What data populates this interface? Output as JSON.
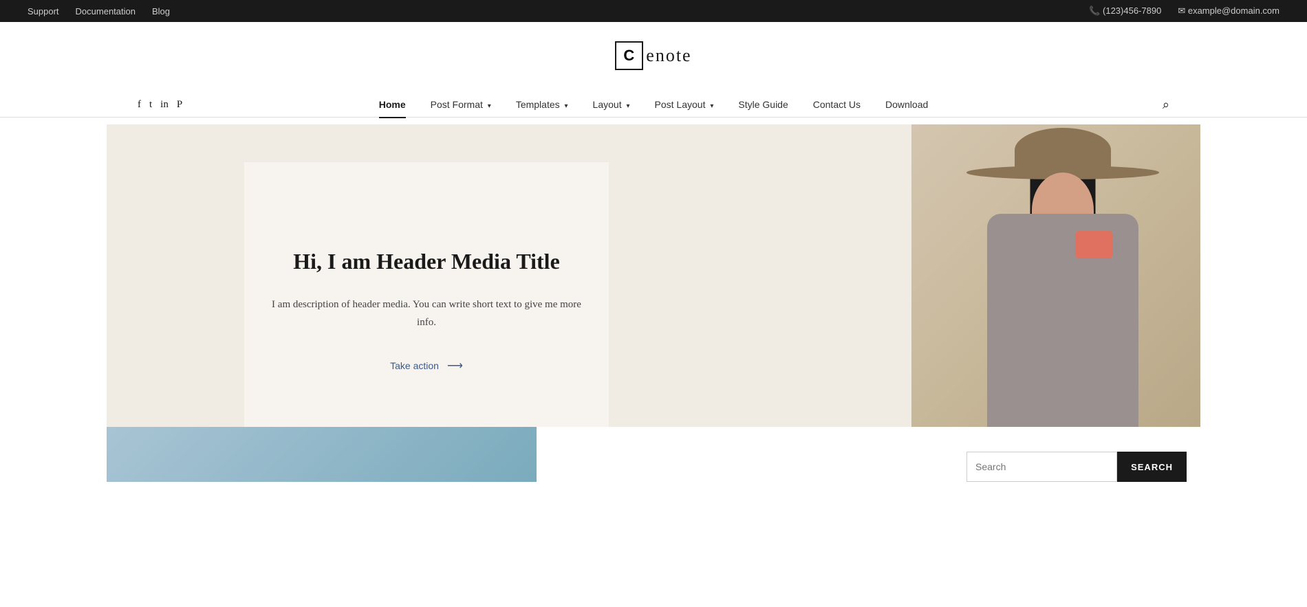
{
  "topbar": {
    "links": [
      "Support",
      "Documentation",
      "Blog"
    ],
    "phone": "(123)456-7890",
    "email": "example@domain.com",
    "phone_icon": "📞",
    "email_icon": "✉"
  },
  "logo": {
    "letter": "C",
    "brand": "enote"
  },
  "social": {
    "facebook": "f",
    "twitter": "𝕏",
    "linkedin": "in",
    "pinterest": "P"
  },
  "nav": {
    "items": [
      {
        "label": "Home",
        "active": true,
        "has_dropdown": false
      },
      {
        "label": "Post Format",
        "active": false,
        "has_dropdown": true
      },
      {
        "label": "Templates",
        "active": false,
        "has_dropdown": true
      },
      {
        "label": "Layout",
        "active": false,
        "has_dropdown": true
      },
      {
        "label": "Post Layout",
        "active": false,
        "has_dropdown": true
      },
      {
        "label": "Style Guide",
        "active": false,
        "has_dropdown": false
      },
      {
        "label": "Contact Us",
        "active": false,
        "has_dropdown": false
      },
      {
        "label": "Download",
        "active": false,
        "has_dropdown": false
      }
    ]
  },
  "hero": {
    "title": "Hi, I am Header Media Title",
    "description": "I am description of header media. You can write short text to give me more info.",
    "cta_text": "Take action",
    "cta_arrow": "⟶"
  },
  "search": {
    "placeholder": "Search",
    "button_label": "SEARCH"
  }
}
